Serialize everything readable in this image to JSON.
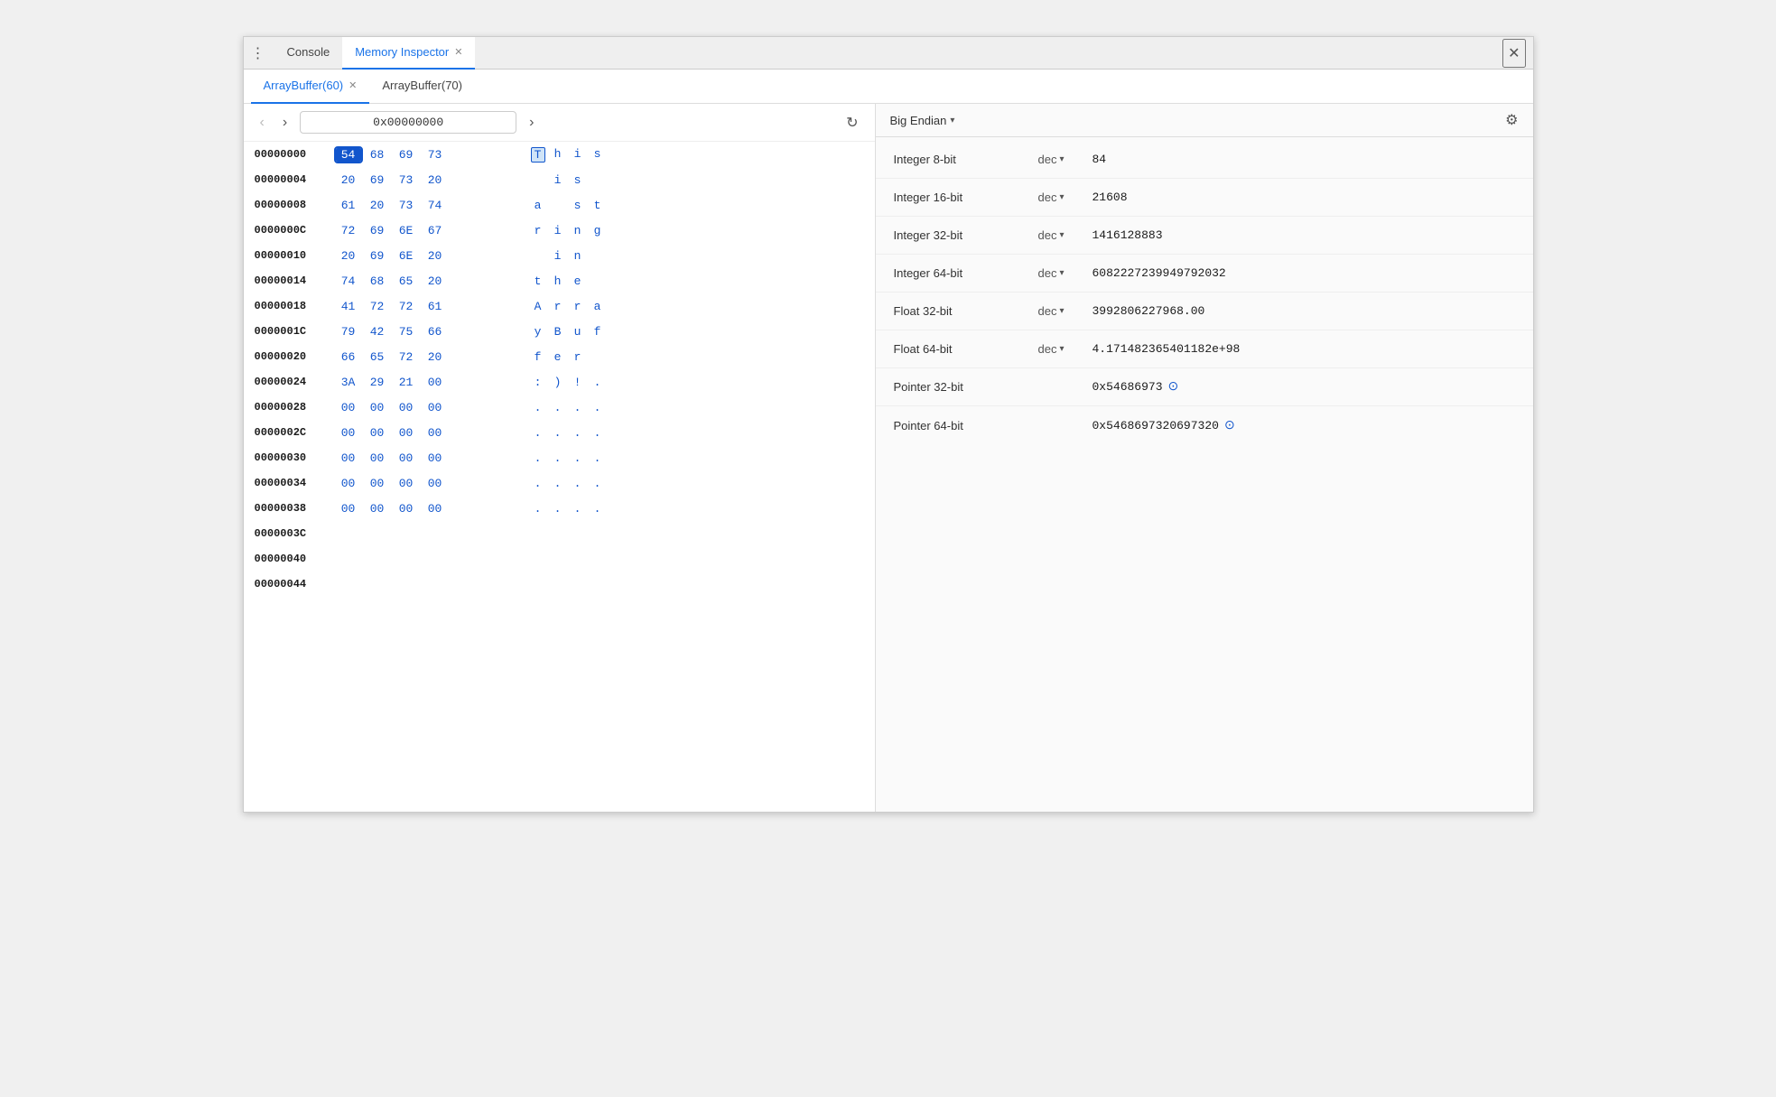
{
  "window": {
    "close_label": "✕"
  },
  "top_tabs": [
    {
      "id": "console",
      "label": "Console",
      "active": false,
      "closeable": false
    },
    {
      "id": "memory-inspector",
      "label": "Memory Inspector",
      "active": true,
      "closeable": true
    }
  ],
  "three_dots": "⋮",
  "sub_tabs": [
    {
      "id": "arraybuffer-60",
      "label": "ArrayBuffer(60)",
      "active": true,
      "closeable": true
    },
    {
      "id": "arraybuffer-70",
      "label": "ArrayBuffer(70)",
      "active": false,
      "closeable": false
    }
  ],
  "nav": {
    "back_label": "‹",
    "forward_label": "›",
    "back_disabled": true,
    "forward_disabled": false,
    "address": "0x00000000",
    "refresh_label": "↻"
  },
  "memory_rows": [
    {
      "addr": "00000000",
      "bytes": [
        "54",
        "68",
        "69",
        "73"
      ],
      "ascii": [
        "T",
        "h",
        "i",
        "s"
      ],
      "selected_byte": 0,
      "selected_ascii": 0
    },
    {
      "addr": "00000004",
      "bytes": [
        "20",
        "69",
        "73",
        "20"
      ],
      "ascii": [
        " ",
        "i",
        "s",
        " "
      ],
      "selected_byte": -1,
      "selected_ascii": -1
    },
    {
      "addr": "00000008",
      "bytes": [
        "61",
        "20",
        "73",
        "74"
      ],
      "ascii": [
        "a",
        " ",
        "s",
        "t"
      ],
      "selected_byte": -1,
      "selected_ascii": -1
    },
    {
      "addr": "0000000C",
      "bytes": [
        "72",
        "69",
        "6E",
        "67"
      ],
      "ascii": [
        "r",
        "i",
        "n",
        "g"
      ],
      "selected_byte": -1,
      "selected_ascii": -1
    },
    {
      "addr": "00000010",
      "bytes": [
        "20",
        "69",
        "6E",
        "20"
      ],
      "ascii": [
        " ",
        "i",
        "n",
        " "
      ],
      "selected_byte": -1,
      "selected_ascii": -1
    },
    {
      "addr": "00000014",
      "bytes": [
        "74",
        "68",
        "65",
        "20"
      ],
      "ascii": [
        "t",
        "h",
        "e",
        " "
      ],
      "selected_byte": -1,
      "selected_ascii": -1
    },
    {
      "addr": "00000018",
      "bytes": [
        "41",
        "72",
        "72",
        "61"
      ],
      "ascii": [
        "A",
        "r",
        "r",
        "a"
      ],
      "selected_byte": -1,
      "selected_ascii": -1
    },
    {
      "addr": "0000001C",
      "bytes": [
        "79",
        "42",
        "75",
        "66"
      ],
      "ascii": [
        "y",
        "B",
        "u",
        "f"
      ],
      "selected_byte": -1,
      "selected_ascii": -1
    },
    {
      "addr": "00000020",
      "bytes": [
        "66",
        "65",
        "72",
        "20"
      ],
      "ascii": [
        "f",
        "e",
        "r",
        " "
      ],
      "selected_byte": -1,
      "selected_ascii": -1
    },
    {
      "addr": "00000024",
      "bytes": [
        "3A",
        "29",
        "21",
        "00"
      ],
      "ascii": [
        ":",
        ")",
        "!",
        "."
      ],
      "selected_byte": -1,
      "selected_ascii": -1
    },
    {
      "addr": "00000028",
      "bytes": [
        "00",
        "00",
        "00",
        "00"
      ],
      "ascii": [
        ".",
        ".",
        ".",
        "."
      ],
      "selected_byte": -1,
      "selected_ascii": -1
    },
    {
      "addr": "0000002C",
      "bytes": [
        "00",
        "00",
        "00",
        "00"
      ],
      "ascii": [
        ".",
        ".",
        ".",
        "."
      ],
      "selected_byte": -1,
      "selected_ascii": -1
    },
    {
      "addr": "00000030",
      "bytes": [
        "00",
        "00",
        "00",
        "00"
      ],
      "ascii": [
        ".",
        ".",
        ".",
        "."
      ],
      "selected_byte": -1,
      "selected_ascii": -1
    },
    {
      "addr": "00000034",
      "bytes": [
        "00",
        "00",
        "00",
        "00"
      ],
      "ascii": [
        ".",
        ".",
        ".",
        "."
      ],
      "selected_byte": -1,
      "selected_ascii": -1
    },
    {
      "addr": "00000038",
      "bytes": [
        "00",
        "00",
        "00",
        "00"
      ],
      "ascii": [
        ".",
        ".",
        ".",
        "."
      ],
      "selected_byte": -1,
      "selected_ascii": -1
    },
    {
      "addr": "0000003C",
      "bytes": [],
      "ascii": [],
      "selected_byte": -1,
      "selected_ascii": -1
    },
    {
      "addr": "00000040",
      "bytes": [],
      "ascii": [],
      "selected_byte": -1,
      "selected_ascii": -1
    },
    {
      "addr": "00000044",
      "bytes": [],
      "ascii": [],
      "selected_byte": -1,
      "selected_ascii": -1
    }
  ],
  "right_panel": {
    "endian_label": "Big Endian",
    "dropdown_arrow": "▾",
    "gear_label": "⚙",
    "inspector_rows": [
      {
        "type": "Integer 8-bit",
        "format": "dec",
        "has_dropdown": true,
        "value": "84",
        "is_pointer": false
      },
      {
        "type": "Integer 16-bit",
        "format": "dec",
        "has_dropdown": true,
        "value": "21608",
        "is_pointer": false
      },
      {
        "type": "Integer 32-bit",
        "format": "dec",
        "has_dropdown": true,
        "value": "1416128883",
        "is_pointer": false
      },
      {
        "type": "Integer 64-bit",
        "format": "dec",
        "has_dropdown": true,
        "value": "6082227239949792032",
        "is_pointer": false
      },
      {
        "type": "Float 32-bit",
        "format": "dec",
        "has_dropdown": true,
        "value": "3992806227968.00",
        "is_pointer": false
      },
      {
        "type": "Float 64-bit",
        "format": "dec",
        "has_dropdown": true,
        "value": "4.171482365401182e+98",
        "is_pointer": false
      },
      {
        "type": "Pointer 32-bit",
        "format": "",
        "has_dropdown": false,
        "value": "0x54686973",
        "is_pointer": true
      },
      {
        "type": "Pointer 64-bit",
        "format": "",
        "has_dropdown": false,
        "value": "0x5468697320697320",
        "is_pointer": true
      }
    ]
  }
}
